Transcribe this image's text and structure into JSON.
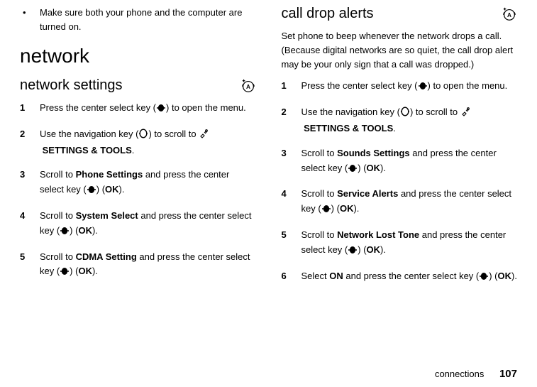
{
  "left": {
    "bullet": "Make sure both your phone and the computer are turned on.",
    "h1": "network",
    "h2": "network settings",
    "steps": [
      {
        "num": "1",
        "pre": "Press the center select key (",
        "post": ") to open the menu.",
        "icon": "center"
      },
      {
        "num": "2",
        "pre": "Use the navigation key (",
        "mid": ") to scroll to ",
        "setting_prefix_icon": true,
        "setting": "SETTINGS & TOOLS",
        "post": ".",
        "icon": "nav"
      },
      {
        "num": "3",
        "pre": "Scroll to ",
        "bold1": "Phone Settings",
        "mid": " and press the center select key (",
        "post": ") (",
        "ok": "OK",
        "tail": ").",
        "icon": "center"
      },
      {
        "num": "4",
        "pre": "Scroll to ",
        "bold1": "System Select",
        "mid": " and press the center select key (",
        "post": ") (",
        "ok": "OK",
        "tail": ").",
        "icon": "center"
      },
      {
        "num": "5",
        "pre": "Scroll to ",
        "bold1": "CDMA Setting",
        "mid": " and press the center select key (",
        "post": ") (",
        "ok": "OK",
        "tail": ").",
        "icon": "center"
      }
    ]
  },
  "right": {
    "h2": "call drop alerts",
    "intro": "Set phone to beep whenever the network drops a call. (Because digital networks are so quiet, the call drop alert may be your only sign that a call was dropped.)",
    "steps": [
      {
        "num": "1",
        "pre": "Press the center select key (",
        "post": ") to open the menu.",
        "icon": "center"
      },
      {
        "num": "2",
        "pre": "Use the navigation key (",
        "mid": ") to scroll to ",
        "setting_prefix_icon": true,
        "setting": "SETTINGS & TOOLS",
        "post": ".",
        "icon": "nav"
      },
      {
        "num": "3",
        "pre": "Scroll to ",
        "bold1": "Sounds Settings",
        "mid": " and press the center select key (",
        "post": ") (",
        "ok": "OK",
        "tail": ").",
        "icon": "center"
      },
      {
        "num": "4",
        "pre": "Scroll to ",
        "bold1": "Service Alerts",
        "mid": " and press the center select key (",
        "post": ") (",
        "ok": "OK",
        "tail": ").",
        "icon": "center"
      },
      {
        "num": "5",
        "pre": "Scroll to ",
        "bold1": "Network Lost Tone",
        "mid": " and press the center select key (",
        "post": ") (",
        "ok": "OK",
        "tail": ").",
        "icon": "center"
      },
      {
        "num": "6",
        "pre": "Select ",
        "bold1": "ON",
        "mid": " and press the center select key (",
        "post": ") (",
        "ok": "OK",
        "tail": ").",
        "icon": "center"
      }
    ]
  },
  "footer": {
    "section": "connections",
    "page": "107"
  },
  "icons": {
    "center": "center-select-key-icon",
    "nav": "navigation-key-icon",
    "settings": "settings-tools-icon",
    "badge": "a-badge-icon"
  }
}
